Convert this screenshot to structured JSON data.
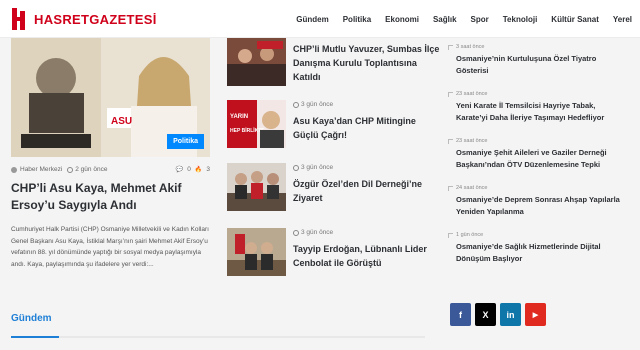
{
  "site": {
    "logo_text": "HASRETGAZETESİ",
    "brand_color": "#d0021b"
  },
  "nav": {
    "items": [
      "Gündem",
      "Politika",
      "Ekonomi",
      "Sağlık",
      "Spor",
      "Teknoloji",
      "Kültür Sanat",
      "Yerel"
    ]
  },
  "lead": {
    "category": "Politika",
    "author": "Haber Merkezi",
    "date": "2 gün önce",
    "comments": "0",
    "likes": "3",
    "title": "CHP’li Asu Kaya, Mehmet Akif Ersoy’u Saygıyla Andı",
    "excerpt": "Cumhuriyet Halk Partisi (CHP) Osmaniye Milletvekili ve Kadın Kolları Genel Başkanı Asu Kaya, İstiklal Marşı’nın şairi Mehmet Akif Ersoy’u vefatının 88. yıl dönümünde yaptığı bir sosyal medya paylaşımıyla andı. Kaya, paylaşımında şu ifadelere yer verdi:..."
  },
  "middle": {
    "items": [
      {
        "date": "",
        "title": "CHP’li Mutlu Yavuzer, Sumbas İlçe Danışma Kurulu Toplantısına Katıldı"
      },
      {
        "date": "3 gün önce",
        "title": "Asu Kaya’dan CHP Mitingine Güçlü Çağrı!"
      },
      {
        "date": "3 gün önce",
        "title": "Özgür Özel’den Dil Derneği’ne Ziyaret"
      },
      {
        "date": "3 gün önce",
        "title": "Tayyip Erdoğan, Lübnanlı Lider Cenbolat ile Görüştü"
      }
    ]
  },
  "section": {
    "title": "Gündem"
  },
  "recent": {
    "items": [
      {
        "date": "3 saat önce",
        "title": "Osmaniye’nin Kurtuluşuna Özel Tiyatro Gösterisi"
      },
      {
        "date": "23 saat önce",
        "title": "Yeni Karate İl Temsilcisi Hayriye Tabak, Karate’yi Daha İleriye Taşımayı Hedefliyor"
      },
      {
        "date": "23 saat önce",
        "title": "Osmaniye Şehit Aileleri ve Gaziler Derneği Başkanı’ndan ÖTV Düzenlemesine Tepki"
      },
      {
        "date": "24 saat önce",
        "title": "Osmaniye’de Deprem Sonrası Ahşap Yapılarla Yeniden Yapılanma"
      },
      {
        "date": "1 gün önce",
        "title": "Osmaniye’de Sağlık Hizmetlerinde Dijital Dönüşüm Başlıyor"
      }
    ]
  },
  "socials": [
    {
      "icon": "facebook-icon",
      "glyph": "f",
      "color": "#3b5998"
    },
    {
      "icon": "x-icon",
      "glyph": "X",
      "color": "#000000"
    },
    {
      "icon": "linkedin-icon",
      "glyph": "in",
      "color": "#0e76a8"
    },
    {
      "icon": "youtube-icon",
      "glyph": "▶",
      "color": "#e02a20"
    }
  ]
}
